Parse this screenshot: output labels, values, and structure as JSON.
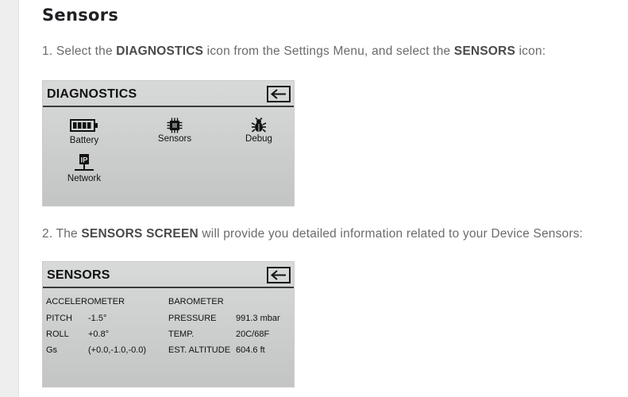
{
  "heading": "Sensors",
  "step1": {
    "num": "1.",
    "pre": "Select the",
    "b1": "DIAGNOSTICS",
    "mid": "icon from the Settings Menu, and select the",
    "b2": "SENSORS",
    "post": "icon:"
  },
  "step2": {
    "num": "2.",
    "pre": "The",
    "b1": "SENSORS SCREEN",
    "post": "will provide you detailed information related to your Device Sensors:"
  },
  "diagnostics_screen": {
    "title": "DIAGNOSTICS",
    "back_icon": "back-arrow-icon",
    "tiles": [
      {
        "label": "Battery",
        "icon": "battery-icon"
      },
      {
        "label": "Sensors",
        "icon": "chip-icon"
      },
      {
        "label": "Debug",
        "icon": "bug-icon"
      },
      {
        "label": "Network",
        "icon": "network-ip-icon",
        "icon_text": "IP"
      }
    ]
  },
  "sensors_screen": {
    "title": "SENSORS",
    "back_icon": "back-arrow-icon",
    "accelerometer": {
      "header": "ACCELEROMETER",
      "rows": [
        {
          "label": "PITCH",
          "value": "-1.5°"
        },
        {
          "label": "ROLL",
          "value": "+0.8°"
        },
        {
          "label": "Gs",
          "value": "(+0.0,-1.0,-0.0)"
        }
      ]
    },
    "barometer": {
      "header": "BAROMETER",
      "rows": [
        {
          "label": "PRESSURE",
          "value": "991.3 mbar"
        },
        {
          "label": "TEMP.",
          "value": "20C/68F"
        },
        {
          "label": "EST. ALTITUDE",
          "value": "604.6 ft"
        }
      ]
    }
  },
  "colors": {
    "rail": "#eeeeee",
    "screen_bg": "#cfd0d0",
    "text": "#6b6b6b",
    "heading": "#202124"
  }
}
